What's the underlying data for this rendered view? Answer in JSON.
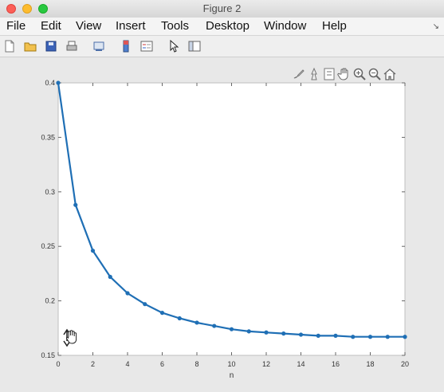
{
  "window": {
    "title": "Figure 2"
  },
  "menu": {
    "items": [
      "File",
      "Edit",
      "View",
      "Insert",
      "Tools",
      "Desktop",
      "Window",
      "Help"
    ]
  },
  "toolbar": {
    "icons": [
      "new-figure-icon",
      "open-file-icon",
      "save-icon",
      "print-icon",
      "link-plot-icon",
      "colorbar-icon",
      "legend-icon",
      "pointer-icon",
      "plot-tools-icon"
    ]
  },
  "axes_toolbar": {
    "icons": [
      "brush-icon",
      "data-cursor-icon",
      "rotate-icon",
      "pan-icon",
      "zoom-in-icon",
      "zoom-out-icon",
      "home-icon"
    ]
  },
  "colors": {
    "line": "#1f6fb5",
    "marker": "#1f6fb5"
  },
  "chart_data": {
    "type": "line",
    "xlabel": "n",
    "ylabel": "",
    "title": "",
    "xlim": [
      0,
      20
    ],
    "ylim": [
      0.15,
      0.4
    ],
    "xticks": [
      "0",
      "2",
      "4",
      "6",
      "8",
      "10",
      "12",
      "14",
      "16",
      "18",
      "20"
    ],
    "yticks": [
      "0.15",
      "0.2",
      "0.25",
      "0.3",
      "0.35",
      "0.4"
    ],
    "grid": false,
    "series": [
      {
        "x": [
          0,
          1,
          2,
          3,
          4,
          5,
          6,
          7,
          8,
          9,
          10,
          11,
          12,
          13,
          14,
          15,
          16,
          17,
          18,
          19,
          20
        ],
        "values": [
          0.4,
          0.288,
          0.246,
          0.222,
          0.207,
          0.197,
          0.189,
          0.184,
          0.18,
          0.177,
          0.174,
          0.172,
          0.171,
          0.17,
          0.169,
          0.168,
          0.168,
          0.167,
          0.167,
          0.167,
          0.167
        ]
      }
    ]
  }
}
